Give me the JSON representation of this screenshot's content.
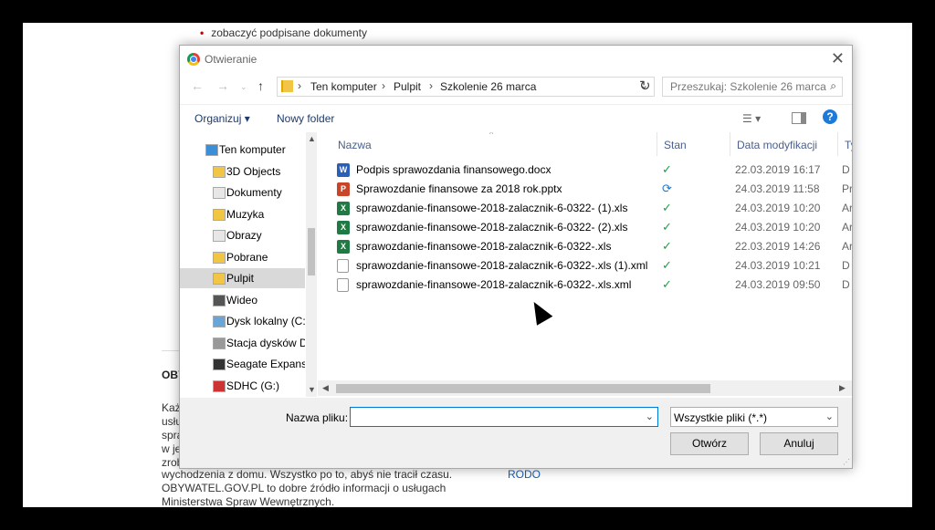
{
  "background_page": {
    "bullet_item": "zobaczyć podpisane dokumenty",
    "section_heading": "OBY",
    "left_fragments": [
      "Każ",
      "usłu",
      "spra",
      "w je",
      "zrob"
    ],
    "paragraph_lines": [
      "wychodzenia z domu. Wszystko po to, abyś nie tracił czasu.",
      "OBYWATEL.GOV.PL to dobre źródło informacji o usługach",
      "Ministerstwa Spraw Wewnętrznych."
    ],
    "link_rodo": "RODO"
  },
  "dialog": {
    "title": "Otwieranie",
    "breadcrumb": [
      "Ten komputer",
      "Pulpit",
      "Szkolenie 26 marca"
    ],
    "search_placeholder": "Przeszukaj: Szkolenie 26 marca",
    "toolbar": {
      "organize": "Organizuj ▾",
      "new_folder": "Nowy folder"
    },
    "nav_tree": [
      {
        "label": "Ten komputer",
        "icon": "computer-icon",
        "color": "#3a8fd8"
      },
      {
        "label": "3D Objects",
        "icon": "folder-3d-icon",
        "color": "#f2c544"
      },
      {
        "label": "Dokumenty",
        "icon": "documents-icon",
        "color": "#e7e7e7"
      },
      {
        "label": "Muzyka",
        "icon": "music-icon",
        "color": "#f2c544"
      },
      {
        "label": "Obrazy",
        "icon": "pictures-icon",
        "color": "#e7e7e7"
      },
      {
        "label": "Pobrane",
        "icon": "downloads-icon",
        "color": "#f2c544"
      },
      {
        "label": "Pulpit",
        "icon": "desktop-icon",
        "color": "#f2c544",
        "selected": true
      },
      {
        "label": "Wideo",
        "icon": "video-icon",
        "color": "#555"
      },
      {
        "label": "Dysk lokalny (C:)",
        "icon": "drive-icon",
        "color": "#6aa5d8"
      },
      {
        "label": "Stacja dysków D",
        "icon": "dvd-icon",
        "color": "#999"
      },
      {
        "label": "Seagate Expansi",
        "icon": "external-drive-icon",
        "color": "#333"
      },
      {
        "label": "SDHC (G:)",
        "icon": "sd-card-icon",
        "color": "#c33"
      }
    ],
    "columns": {
      "name": "Nazwa",
      "state": "Stan",
      "modified": "Data modyfikacji",
      "type": "Ty"
    },
    "files": [
      {
        "name": "Podpis sprawozdania finansowego.docx",
        "kind": "docx",
        "badge": "W",
        "state": "ok",
        "date": "22.03.2019 16:17",
        "type": "D"
      },
      {
        "name": "Sprawozdanie finansowe za 2018 rok.pptx",
        "kind": "pptx",
        "badge": "P",
        "state": "sync",
        "date": "24.03.2019 11:58",
        "type": "Pr"
      },
      {
        "name": "sprawozdanie-finansowe-2018-zalacznik-6-0322- (1).xls",
        "kind": "xls",
        "badge": "X",
        "state": "ok",
        "date": "24.03.2019 10:20",
        "type": "Ar"
      },
      {
        "name": "sprawozdanie-finansowe-2018-zalacznik-6-0322- (2).xls",
        "kind": "xls",
        "badge": "X",
        "state": "ok",
        "date": "24.03.2019 10:20",
        "type": "Ar"
      },
      {
        "name": "sprawozdanie-finansowe-2018-zalacznik-6-0322-.xls",
        "kind": "xls",
        "badge": "X",
        "state": "ok",
        "date": "22.03.2019 14:26",
        "type": "Ar"
      },
      {
        "name": "sprawozdanie-finansowe-2018-zalacznik-6-0322-.xls (1).xml",
        "kind": "xml",
        "badge": "",
        "state": "ok",
        "date": "24.03.2019 10:21",
        "type": "D"
      },
      {
        "name": "sprawozdanie-finansowe-2018-zalacznik-6-0322-.xls.xml",
        "kind": "xml",
        "badge": "",
        "state": "ok",
        "date": "24.03.2019 09:50",
        "type": "D"
      }
    ],
    "filename_label": "Nazwa pliku:",
    "filename_value": "",
    "filter_value": "Wszystkie pliki (*.*)",
    "open_button": "Otwórz",
    "cancel_button": "Anuluj",
    "icons": {
      "state_ok": "✓",
      "state_sync": "⟳"
    }
  }
}
